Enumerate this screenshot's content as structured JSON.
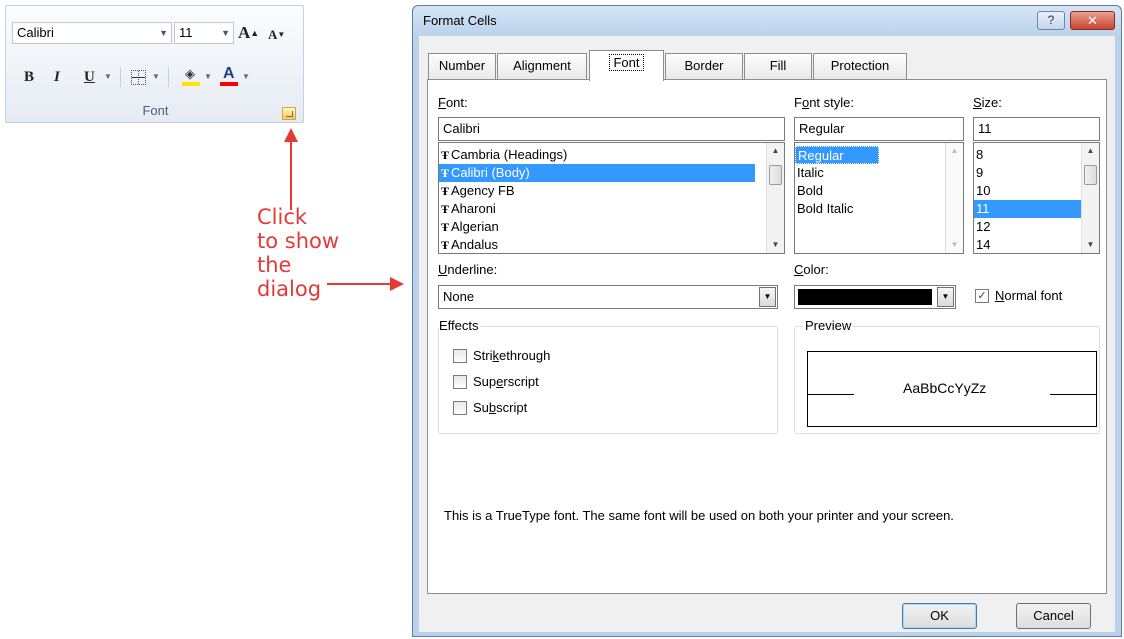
{
  "ribbon": {
    "font_name": "Calibri",
    "font_size": "11",
    "grow_font": "A",
    "shrink_font": "A",
    "bold": "B",
    "italic": "I",
    "underline": "U",
    "font_color": "A",
    "group_label": "Font",
    "highlight_color": "#ffe400",
    "font_color_bar": "#ff0000"
  },
  "annotation": {
    "line1": "Click",
    "line2": "to show",
    "line3": "the",
    "line4": "dialog",
    "color": "#e53935"
  },
  "dialog": {
    "title": "Format Cells",
    "help": "?",
    "close": "✕",
    "tabs": [
      "Number",
      "Alignment",
      "Font",
      "Border",
      "Fill",
      "Protection"
    ],
    "active_tab": "Font",
    "font": {
      "label": "Font:",
      "value": "Calibri",
      "items": [
        "Cambria (Headings)",
        "Calibri (Body)",
        "Agency FB",
        "Aharoni",
        "Algerian",
        "Andalus"
      ],
      "selected": "Calibri (Body)"
    },
    "font_style": {
      "label": "Font style:",
      "value": "Regular",
      "items": [
        "Regular",
        "Italic",
        "Bold",
        "Bold Italic"
      ],
      "selected": "Regular"
    },
    "size": {
      "label": "Size:",
      "value": "11",
      "items": [
        "8",
        "9",
        "10",
        "11",
        "12",
        "14"
      ],
      "selected": "11"
    },
    "underline": {
      "label": "Underline:",
      "value": "None"
    },
    "color": {
      "label": "Color:",
      "value": "#000000"
    },
    "normal_font": {
      "label": "Normal font",
      "checked": true
    },
    "effects": {
      "label": "Effects",
      "strikethrough": "Strikethrough",
      "superscript": "Superscript",
      "subscript": "Subscript"
    },
    "preview": {
      "label": "Preview",
      "sample": "AaBbCcYyZz"
    },
    "note": "This is a TrueType font.  The same font will be used on both your printer and your screen.",
    "ok": "OK",
    "cancel": "Cancel"
  }
}
